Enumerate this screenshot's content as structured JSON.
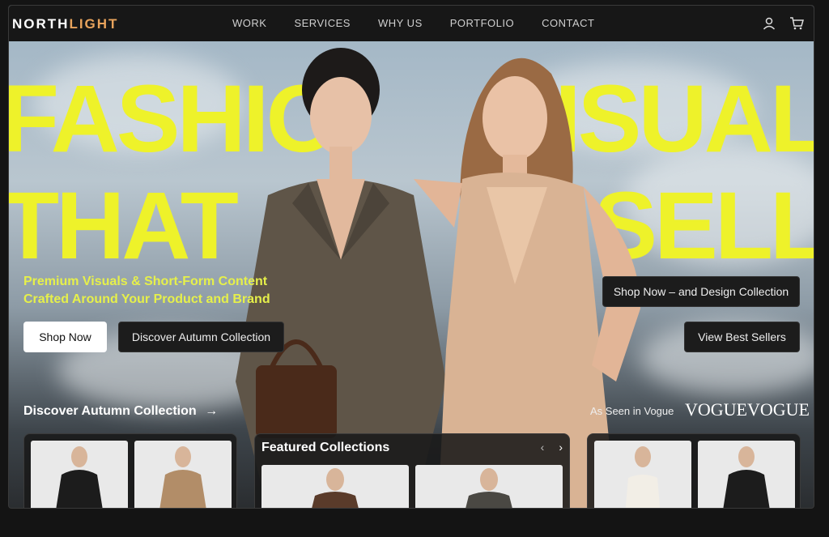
{
  "brand": {
    "part1": "NORTH",
    "part2": "LIGHT"
  },
  "nav": [
    "WORK",
    "SERVICES",
    "WHY US",
    "PORTFOLIO",
    "CONTACT"
  ],
  "nav_icons": [
    "user-icon",
    "cart-icon"
  ],
  "hero": {
    "headline_line1_left": "FASHIO",
    "headline_line1_right": "ISUAL",
    "headline_line2_left": "THAT",
    "headline_line2_right": "SELL",
    "subtitle_line1": "Premium Visuals & Short-Form Content",
    "subtitle_line2": "Crafted Around Your Product and Brand",
    "shop_now": "Shop Now",
    "discover_autumn": "Discover Autumn Collection",
    "shop_design": "Shop Now – and Design Collection",
    "view_best": "View Best Sellers"
  },
  "discover_link": "Discover Autumn Collection",
  "as_seen": "As Seen in Vogue",
  "vogue_logos": [
    "VOGUE",
    "VOGUE"
  ],
  "featured": {
    "title": "Featured Collections",
    "prev": "‹",
    "next": "›"
  },
  "colors": {
    "accent": "#eef22a",
    "brand_accent": "#e8a35c",
    "bg": "#141414"
  }
}
